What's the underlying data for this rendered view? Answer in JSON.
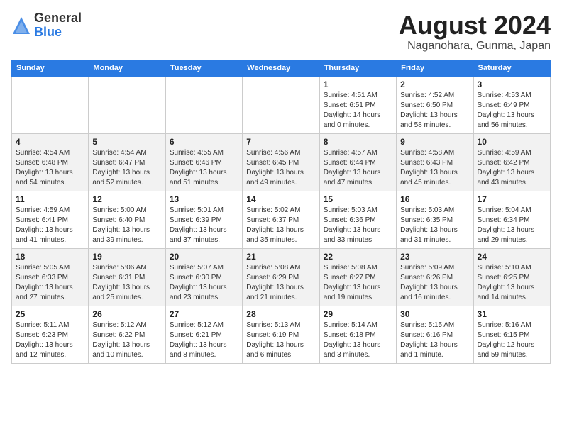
{
  "logo": {
    "general": "General",
    "blue": "Blue"
  },
  "title": "August 2024",
  "subtitle": "Naganohara, Gunma, Japan",
  "weekdays": [
    "Sunday",
    "Monday",
    "Tuesday",
    "Wednesday",
    "Thursday",
    "Friday",
    "Saturday"
  ],
  "weeks": [
    [
      {
        "day": "",
        "info": ""
      },
      {
        "day": "",
        "info": ""
      },
      {
        "day": "",
        "info": ""
      },
      {
        "day": "",
        "info": ""
      },
      {
        "day": "1",
        "info": "Sunrise: 4:51 AM\nSunset: 6:51 PM\nDaylight: 14 hours\nand 0 minutes."
      },
      {
        "day": "2",
        "info": "Sunrise: 4:52 AM\nSunset: 6:50 PM\nDaylight: 13 hours\nand 58 minutes."
      },
      {
        "day": "3",
        "info": "Sunrise: 4:53 AM\nSunset: 6:49 PM\nDaylight: 13 hours\nand 56 minutes."
      }
    ],
    [
      {
        "day": "4",
        "info": "Sunrise: 4:54 AM\nSunset: 6:48 PM\nDaylight: 13 hours\nand 54 minutes."
      },
      {
        "day": "5",
        "info": "Sunrise: 4:54 AM\nSunset: 6:47 PM\nDaylight: 13 hours\nand 52 minutes."
      },
      {
        "day": "6",
        "info": "Sunrise: 4:55 AM\nSunset: 6:46 PM\nDaylight: 13 hours\nand 51 minutes."
      },
      {
        "day": "7",
        "info": "Sunrise: 4:56 AM\nSunset: 6:45 PM\nDaylight: 13 hours\nand 49 minutes."
      },
      {
        "day": "8",
        "info": "Sunrise: 4:57 AM\nSunset: 6:44 PM\nDaylight: 13 hours\nand 47 minutes."
      },
      {
        "day": "9",
        "info": "Sunrise: 4:58 AM\nSunset: 6:43 PM\nDaylight: 13 hours\nand 45 minutes."
      },
      {
        "day": "10",
        "info": "Sunrise: 4:59 AM\nSunset: 6:42 PM\nDaylight: 13 hours\nand 43 minutes."
      }
    ],
    [
      {
        "day": "11",
        "info": "Sunrise: 4:59 AM\nSunset: 6:41 PM\nDaylight: 13 hours\nand 41 minutes."
      },
      {
        "day": "12",
        "info": "Sunrise: 5:00 AM\nSunset: 6:40 PM\nDaylight: 13 hours\nand 39 minutes."
      },
      {
        "day": "13",
        "info": "Sunrise: 5:01 AM\nSunset: 6:39 PM\nDaylight: 13 hours\nand 37 minutes."
      },
      {
        "day": "14",
        "info": "Sunrise: 5:02 AM\nSunset: 6:37 PM\nDaylight: 13 hours\nand 35 minutes."
      },
      {
        "day": "15",
        "info": "Sunrise: 5:03 AM\nSunset: 6:36 PM\nDaylight: 13 hours\nand 33 minutes."
      },
      {
        "day": "16",
        "info": "Sunrise: 5:03 AM\nSunset: 6:35 PM\nDaylight: 13 hours\nand 31 minutes."
      },
      {
        "day": "17",
        "info": "Sunrise: 5:04 AM\nSunset: 6:34 PM\nDaylight: 13 hours\nand 29 minutes."
      }
    ],
    [
      {
        "day": "18",
        "info": "Sunrise: 5:05 AM\nSunset: 6:33 PM\nDaylight: 13 hours\nand 27 minutes."
      },
      {
        "day": "19",
        "info": "Sunrise: 5:06 AM\nSunset: 6:31 PM\nDaylight: 13 hours\nand 25 minutes."
      },
      {
        "day": "20",
        "info": "Sunrise: 5:07 AM\nSunset: 6:30 PM\nDaylight: 13 hours\nand 23 minutes."
      },
      {
        "day": "21",
        "info": "Sunrise: 5:08 AM\nSunset: 6:29 PM\nDaylight: 13 hours\nand 21 minutes."
      },
      {
        "day": "22",
        "info": "Sunrise: 5:08 AM\nSunset: 6:27 PM\nDaylight: 13 hours\nand 19 minutes."
      },
      {
        "day": "23",
        "info": "Sunrise: 5:09 AM\nSunset: 6:26 PM\nDaylight: 13 hours\nand 16 minutes."
      },
      {
        "day": "24",
        "info": "Sunrise: 5:10 AM\nSunset: 6:25 PM\nDaylight: 13 hours\nand 14 minutes."
      }
    ],
    [
      {
        "day": "25",
        "info": "Sunrise: 5:11 AM\nSunset: 6:23 PM\nDaylight: 13 hours\nand 12 minutes."
      },
      {
        "day": "26",
        "info": "Sunrise: 5:12 AM\nSunset: 6:22 PM\nDaylight: 13 hours\nand 10 minutes."
      },
      {
        "day": "27",
        "info": "Sunrise: 5:12 AM\nSunset: 6:21 PM\nDaylight: 13 hours\nand 8 minutes."
      },
      {
        "day": "28",
        "info": "Sunrise: 5:13 AM\nSunset: 6:19 PM\nDaylight: 13 hours\nand 6 minutes."
      },
      {
        "day": "29",
        "info": "Sunrise: 5:14 AM\nSunset: 6:18 PM\nDaylight: 13 hours\nand 3 minutes."
      },
      {
        "day": "30",
        "info": "Sunrise: 5:15 AM\nSunset: 6:16 PM\nDaylight: 13 hours\nand 1 minute."
      },
      {
        "day": "31",
        "info": "Sunrise: 5:16 AM\nSunset: 6:15 PM\nDaylight: 12 hours\nand 59 minutes."
      }
    ]
  ]
}
